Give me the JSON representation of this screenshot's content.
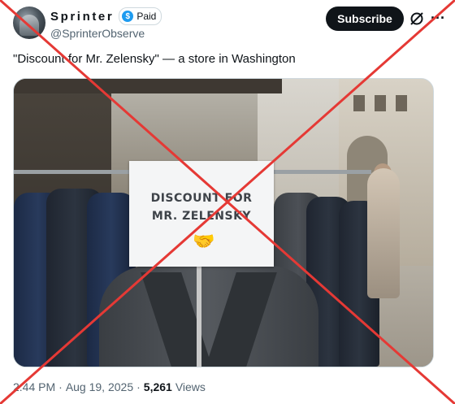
{
  "tweet": {
    "display_name": "Sprinter",
    "paid_label": "Paid",
    "handle": "@SprinterObserve",
    "subscribe_label": "Subscribe",
    "text": "\"Discount for Mr. Zelensky\" — a store in Washington",
    "time": "2:44 PM",
    "date": "Aug 19, 2025",
    "separator": "·",
    "views_count": "5,261",
    "views_label": "Views"
  },
  "image": {
    "sign_line1": "DISCOUNT FOR",
    "sign_line2": "MR. ZELENSKY",
    "sign_emoji": "🤝"
  },
  "overlay": {
    "cross_color": "#e53935"
  },
  "icons": {
    "badge": "dollar-verified-icon",
    "grok": "grok-icon",
    "more": "more-options-icon"
  }
}
